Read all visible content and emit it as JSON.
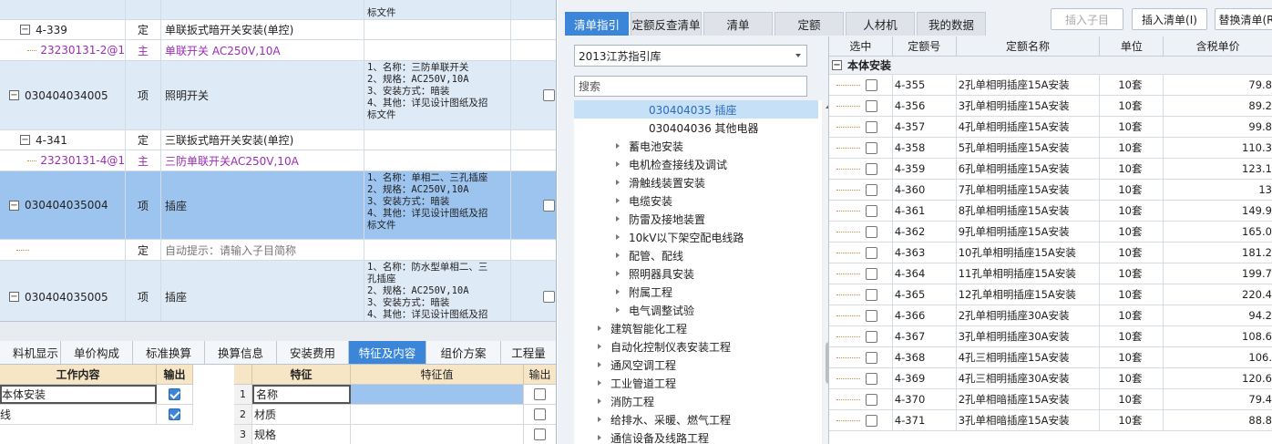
{
  "grid": {
    "rows": [
      {
        "kind": "item-tail",
        "feature": "标文件"
      },
      {
        "kind": "quota",
        "code": "4-339",
        "type": "定",
        "name": "单联扳式暗开关安装(单控)"
      },
      {
        "kind": "material",
        "code": "23230131-2@1",
        "type": "主",
        "name": "单联开关 AC250V,10A"
      },
      {
        "kind": "item",
        "code": "030404034005",
        "type": "项",
        "name": "照明开关",
        "feature": "1、名称：三防单联开关\n2、规格：AC250V,10A\n3、安装方式：暗装\n4、其他：详见设计图纸及招\n标文件"
      },
      {
        "kind": "quota",
        "code": "4-341",
        "type": "定",
        "name": "三联扳式暗开关安装(单控)"
      },
      {
        "kind": "material",
        "code": "23230131-4@1",
        "type": "主",
        "name": "三防单联开关AC250V,10A"
      },
      {
        "kind": "selected",
        "code": "030404035004",
        "type": "项",
        "name": "插座",
        "feature": "1、名称：单相二、三孔插座\n2、规格：AC250V,10A\n3、安装方式：暗装\n4、其他：详见设计图纸及招\n标文件"
      },
      {
        "kind": "hint",
        "type": "定",
        "name": "自动提示：请输入子目简称"
      },
      {
        "kind": "item",
        "code": "030404035005",
        "type": "项",
        "name": "插座",
        "feature": "1、名称：防水型单相二、三\n孔插座\n2、规格：AC250V,10A\n3、安装方式：暗装\n4、其他：详见设计图纸及招"
      }
    ]
  },
  "bottom_tabs": [
    {
      "label": "料机显示",
      "active": false
    },
    {
      "label": "单价构成",
      "active": false
    },
    {
      "label": "标准换算",
      "active": false
    },
    {
      "label": "换算信息",
      "active": false
    },
    {
      "label": "安装费用",
      "active": false
    },
    {
      "label": "特征及内容",
      "active": true
    },
    {
      "label": "组价方案",
      "active": false
    },
    {
      "label": "工程量",
      "active": false
    }
  ],
  "work_content": {
    "headers": [
      "工作内容",
      "输出"
    ],
    "rows": [
      {
        "text": "本体安装",
        "checked": true
      },
      {
        "text": "线",
        "checked": true
      }
    ]
  },
  "features": {
    "headers": [
      "特征",
      "特征值",
      "输出"
    ],
    "rows": [
      {
        "no": "1",
        "name": "名称",
        "value": "",
        "checked": false
      },
      {
        "no": "2",
        "name": "材质",
        "value": "",
        "checked": false
      },
      {
        "no": "3",
        "name": "规格",
        "value": "",
        "checked": false
      }
    ]
  },
  "right_tabs": [
    {
      "label": "清单指引",
      "active": true
    },
    {
      "label": "定额反查清单",
      "active": false
    },
    {
      "label": "清单",
      "active": false
    },
    {
      "label": "定额",
      "active": false
    },
    {
      "label": "人材机",
      "active": false
    },
    {
      "label": "我的数据",
      "active": false
    }
  ],
  "toolbar": {
    "insert_sub": "插入子目",
    "insert_list": "插入清单(I)",
    "replace_list": "替换清单(R"
  },
  "library": {
    "selected": "2013江苏指引库"
  },
  "search": {
    "placeholder": "搜索"
  },
  "tree": [
    {
      "label": "030404035  插座",
      "level": 2,
      "selected": true,
      "arrow": false
    },
    {
      "label": "030404036  其他电器",
      "level": 2,
      "selected": false,
      "arrow": false
    },
    {
      "label": "蓄电池安装",
      "level": 1,
      "selected": false,
      "arrow": true
    },
    {
      "label": "电机检查接线及调试",
      "level": 1,
      "selected": false,
      "arrow": true
    },
    {
      "label": "滑触线装置安装",
      "level": 1,
      "selected": false,
      "arrow": true
    },
    {
      "label": "电缆安装",
      "level": 1,
      "selected": false,
      "arrow": true
    },
    {
      "label": "防雷及接地装置",
      "level": 1,
      "selected": false,
      "arrow": true
    },
    {
      "label": "10kV以下架空配电线路",
      "level": 1,
      "selected": false,
      "arrow": true
    },
    {
      "label": "配管、配线",
      "level": 1,
      "selected": false,
      "arrow": true
    },
    {
      "label": "照明器具安装",
      "level": 1,
      "selected": false,
      "arrow": true
    },
    {
      "label": "附属工程",
      "level": 1,
      "selected": false,
      "arrow": true
    },
    {
      "label": "电气调整试验",
      "level": 1,
      "selected": false,
      "arrow": true
    },
    {
      "label": "建筑智能化工程",
      "level": 0,
      "selected": false,
      "arrow": true
    },
    {
      "label": "自动化控制仪表安装工程",
      "level": 0,
      "selected": false,
      "arrow": true
    },
    {
      "label": "通风空调工程",
      "level": 0,
      "selected": false,
      "arrow": true
    },
    {
      "label": "工业管道工程",
      "level": 0,
      "selected": false,
      "arrow": true
    },
    {
      "label": "消防工程",
      "level": 0,
      "selected": false,
      "arrow": true
    },
    {
      "label": "给排水、采暖、燃气工程",
      "level": 0,
      "selected": false,
      "arrow": true
    },
    {
      "label": "通信设备及线路工程",
      "level": 0,
      "selected": false,
      "arrow": true
    }
  ],
  "quota_grid": {
    "headers": [
      "选中",
      "定额号",
      "定额名称",
      "单位",
      "含税单价"
    ],
    "group": "本体安装",
    "rows": [
      {
        "code": "4-355",
        "name": "2孔单相明插座15A安装",
        "unit": "10套",
        "price": "79.8"
      },
      {
        "code": "4-356",
        "name": "3孔单相明插座15A安装",
        "unit": "10套",
        "price": "89.2"
      },
      {
        "code": "4-357",
        "name": "4孔单相明插座15A安装",
        "unit": "10套",
        "price": "99.8"
      },
      {
        "code": "4-358",
        "name": "5孔单相明插座15A安装",
        "unit": "10套",
        "price": "110.3"
      },
      {
        "code": "4-359",
        "name": "6孔单相明插座15A安装",
        "unit": "10套",
        "price": "123.1"
      },
      {
        "code": "4-360",
        "name": "7孔单相明插座15A安装",
        "unit": "10套",
        "price": "13"
      },
      {
        "code": "4-361",
        "name": "8孔单相明插座15A安装",
        "unit": "10套",
        "price": "149.9"
      },
      {
        "code": "4-362",
        "name": "9孔单相明插座15A安装",
        "unit": "10套",
        "price": "165.0"
      },
      {
        "code": "4-363",
        "name": "10孔单相明插座15A安装",
        "unit": "10套",
        "price": "181.2"
      },
      {
        "code": "4-364",
        "name": "11孔单相明插座15A安装",
        "unit": "10套",
        "price": "199.7"
      },
      {
        "code": "4-365",
        "name": "12孔单相明插座15A安装",
        "unit": "10套",
        "price": "220.4"
      },
      {
        "code": "4-366",
        "name": "2孔单相明插座30A安装",
        "unit": "10套",
        "price": "94.2"
      },
      {
        "code": "4-367",
        "name": "3孔单相明插座30A安装",
        "unit": "10套",
        "price": "108.6"
      },
      {
        "code": "4-368",
        "name": "4孔三相明插座15A安装",
        "unit": "10套",
        "price": "106."
      },
      {
        "code": "4-369",
        "name": "4孔三相明插座30A安装",
        "unit": "10套",
        "price": "120.6"
      },
      {
        "code": "4-370",
        "name": "2孔单相暗插座15A安装",
        "unit": "10套",
        "price": "79.4"
      },
      {
        "code": "4-371",
        "name": "3孔单相暗插座15A安装",
        "unit": "10套",
        "price": "88.8"
      }
    ]
  }
}
